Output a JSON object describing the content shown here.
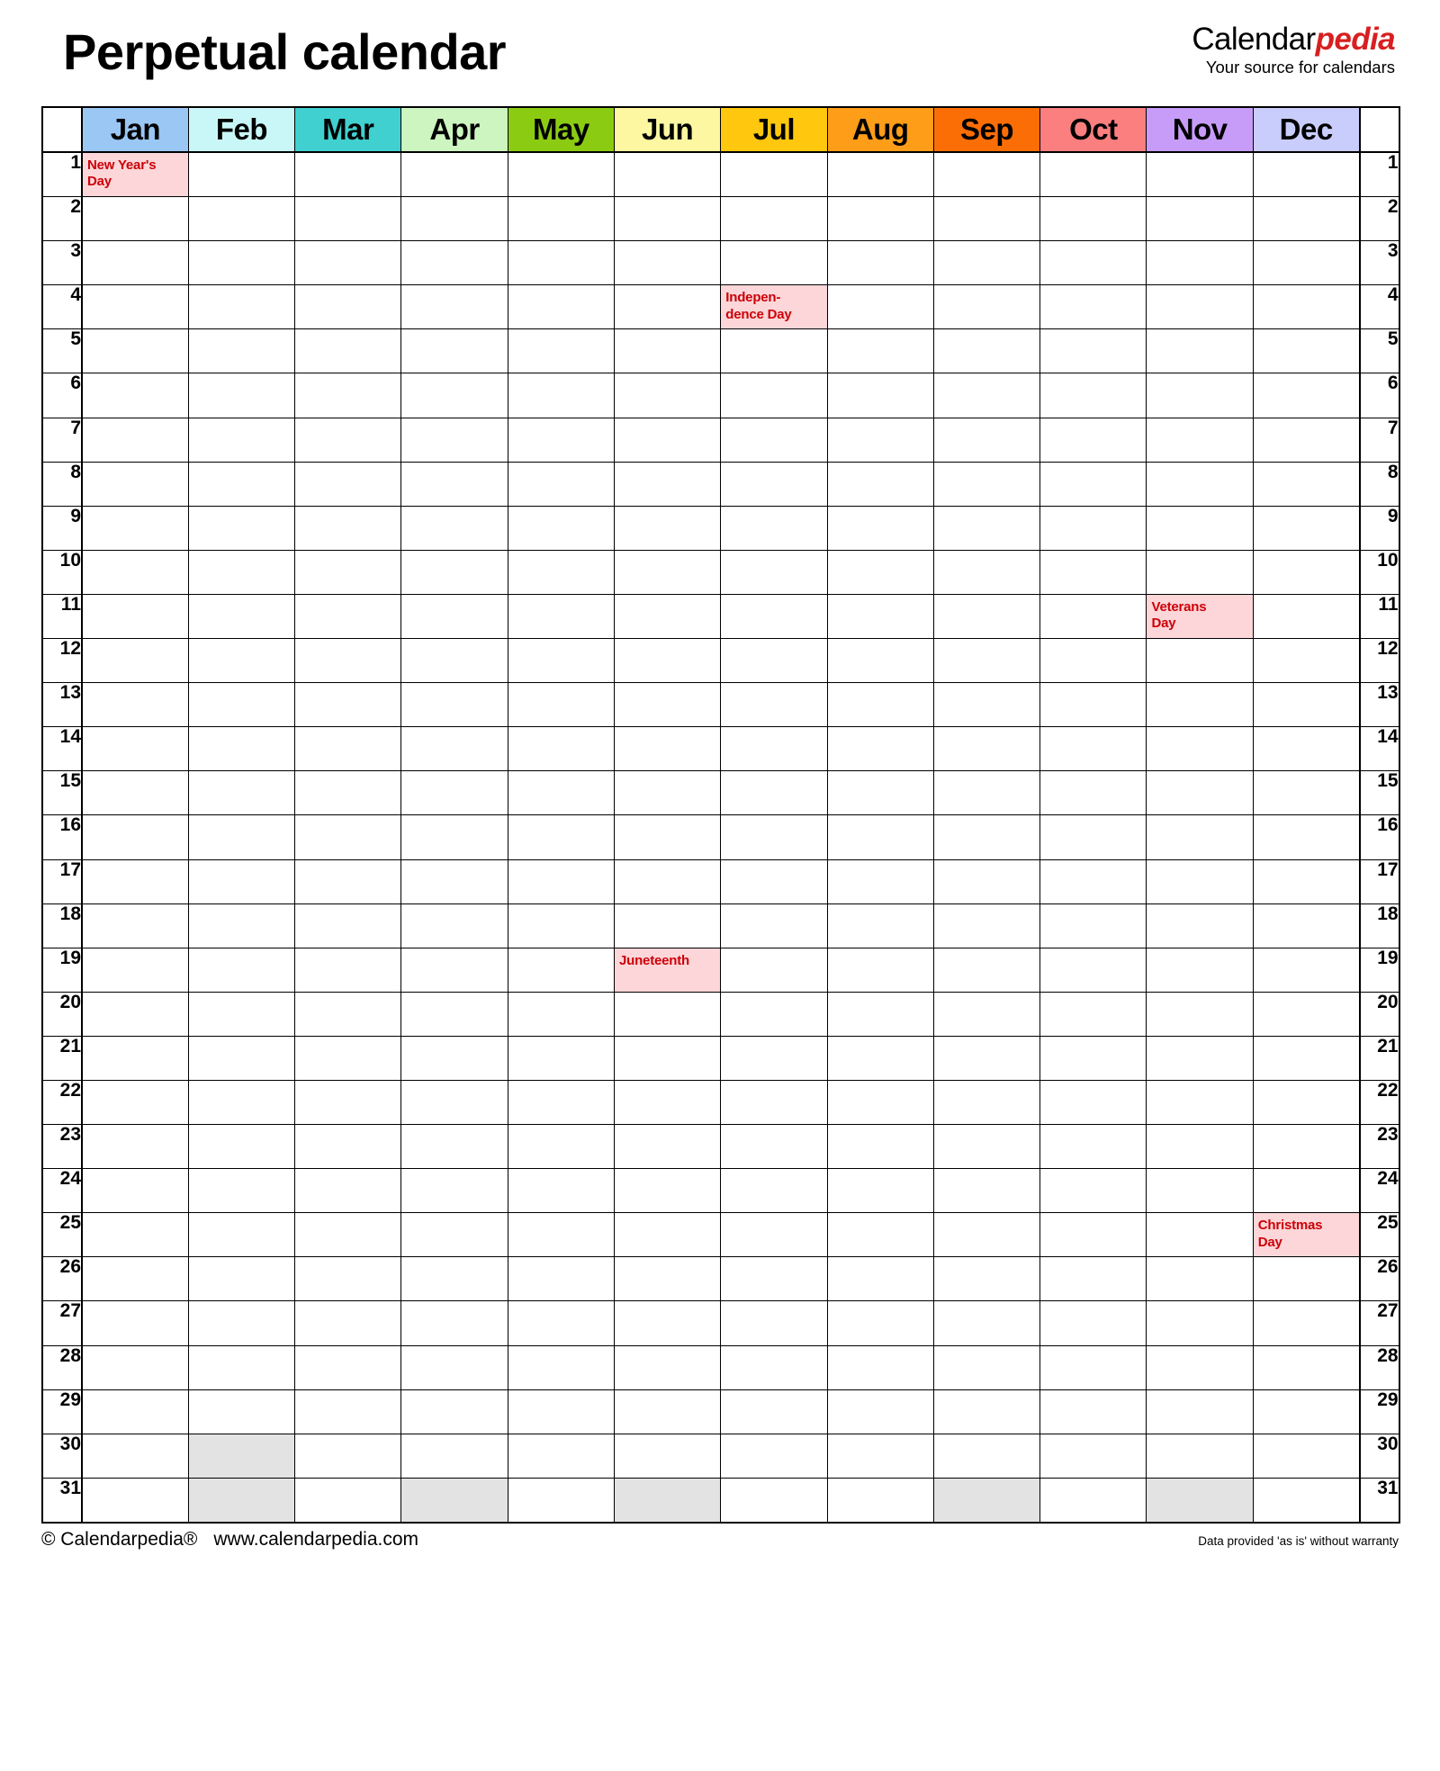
{
  "header": {
    "title": "Perpetual calendar",
    "brand_primary": "Calendar",
    "brand_secondary": "pedia",
    "brand_tagline": "Your source for calendars"
  },
  "months": [
    {
      "label": "Jan",
      "color": "#9ac7f4",
      "days": 31
    },
    {
      "label": "Feb",
      "color": "#c9f7f7",
      "days": 29
    },
    {
      "label": "Mar",
      "color": "#3fd0cf",
      "days": 31
    },
    {
      "label": "Apr",
      "color": "#ccf5c0",
      "days": 30
    },
    {
      "label": "May",
      "color": "#8bcc12",
      "days": 31
    },
    {
      "label": "Jun",
      "color": "#fdf7a1",
      "days": 30
    },
    {
      "label": "Jul",
      "color": "#ffc70d",
      "days": 31
    },
    {
      "label": "Aug",
      "color": "#fd9d18",
      "days": 31
    },
    {
      "label": "Sep",
      "color": "#fb6e06",
      "days": 30
    },
    {
      "label": "Oct",
      "color": "#fb7f7f",
      "days": 31
    },
    {
      "label": "Nov",
      "color": "#c79cf9",
      "days": 30
    },
    {
      "label": "Dec",
      "color": "#c9cdfb",
      "days": 31
    }
  ],
  "day_numbers": [
    1,
    2,
    3,
    4,
    5,
    6,
    7,
    8,
    9,
    10,
    11,
    12,
    13,
    14,
    15,
    16,
    17,
    18,
    19,
    20,
    21,
    22,
    23,
    24,
    25,
    26,
    27,
    28,
    29,
    30,
    31
  ],
  "holidays": [
    {
      "month": "Jan",
      "month_index": 0,
      "day": 1,
      "name": "New Year's Day",
      "lines": [
        "New Year's",
        "Day"
      ]
    },
    {
      "month": "Jun",
      "month_index": 5,
      "day": 19,
      "name": "Juneteenth",
      "lines": [
        "Juneteenth"
      ]
    },
    {
      "month": "Jul",
      "month_index": 6,
      "day": 4,
      "name": "Independence Day",
      "lines": [
        "Indepen-",
        "dence Day"
      ]
    },
    {
      "month": "Nov",
      "month_index": 10,
      "day": 11,
      "name": "Veterans Day",
      "lines": [
        "Veterans",
        "Day"
      ]
    },
    {
      "month": "Dec",
      "month_index": 11,
      "day": 25,
      "name": "Christmas Day",
      "lines": [
        "Christmas",
        "Day"
      ]
    }
  ],
  "colors": {
    "holiday_background": "#fcd6d8",
    "holiday_text": "#cc0008",
    "disabled_cell": "#e3e3e3",
    "grid_line": "#000000",
    "brand_accent": "#d81f20"
  },
  "footer": {
    "copyright": "© Calendarpedia®",
    "website": "www.calendarpedia.com",
    "disclaimer": "Data provided 'as is' without warranty"
  }
}
